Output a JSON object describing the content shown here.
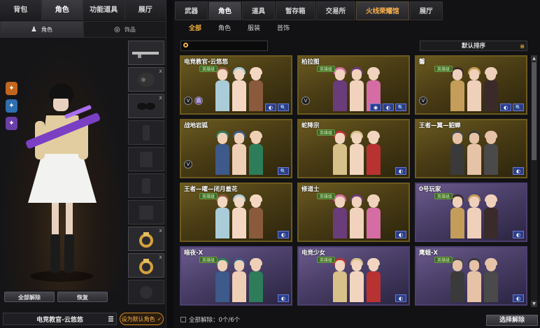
{
  "left_tabs": [
    "背包",
    "角色",
    "功能道具",
    "展厅"
  ],
  "left_active_tab": 1,
  "subtabs": [
    {
      "label": "角色"
    },
    {
      "label": "饰品"
    }
  ],
  "left_buttons": {
    "unlock_all": "全部解除",
    "restore": "恢复"
  },
  "current_character": "电竞教官-云悠悠",
  "set_default": "设为默认角色",
  "set_default_check": "✓",
  "right_tabs": [
    "武器",
    "角色",
    "道具",
    "暂存箱",
    "交易所",
    "火线荣耀馆",
    "展厅"
  ],
  "right_active_tab": 1,
  "right_highlight_tab": 5,
  "category_tabs": [
    "全部",
    "角色",
    "服装",
    "首饰"
  ],
  "category_active": 0,
  "sort_label": "默认排序",
  "cards": [
    {
      "title": "电竞教官-云悠悠",
      "tag": "英雄级",
      "badges": [
        "V",
        "盾"
      ],
      "actions": [
        "◐",
        "🔍"
      ],
      "theme": "gold"
    },
    {
      "title": "柏拉图",
      "tag": "英雄级",
      "badges": [
        "V"
      ],
      "actions": [
        "◉",
        "◐",
        "🔍"
      ],
      "theme": "gold"
    },
    {
      "title": "馨",
      "tag": "英雄级",
      "badges": [
        "V"
      ],
      "actions": [
        "◐",
        "🔍"
      ],
      "theme": "gold"
    },
    {
      "title": "战地岩狐",
      "tag": "",
      "badges": [
        "V"
      ],
      "actions": [
        "🔍"
      ],
      "theme": "gold"
    },
    {
      "title": "蛇降宗",
      "tag": "英雄级",
      "badges": [],
      "actions": [
        "◐"
      ],
      "theme": "gold"
    },
    {
      "title": "王者—翼—貂蝉",
      "tag": "",
      "badges": [],
      "actions": [
        "◐"
      ],
      "theme": "gold"
    },
    {
      "title": "王者—曜—闭月羞花",
      "tag": "英雄级",
      "badges": [],
      "actions": [
        "◐"
      ],
      "theme": "gold"
    },
    {
      "title": "修道士",
      "tag": "英雄级",
      "badges": [],
      "actions": [
        "◐"
      ],
      "theme": "gold"
    },
    {
      "title": "0号玩家",
      "tag": "英雄级",
      "badges": [],
      "actions": [
        "◐"
      ],
      "theme": "purple"
    },
    {
      "title": "暗夜-X",
      "tag": "英雄级",
      "badges": [],
      "actions": [
        "◐"
      ],
      "theme": "purple"
    },
    {
      "title": "电竞少女",
      "tag": "英雄级",
      "badges": [],
      "actions": [
        "◐"
      ],
      "theme": "purple"
    },
    {
      "title": "鹰蛾-X",
      "tag": "英雄级",
      "badges": [],
      "actions": [
        "◐"
      ],
      "theme": "purple"
    }
  ],
  "unlock_status": "全部解除：0个/6个",
  "select_unlock": "选择解除",
  "colors": {
    "accent": "#f0b23c",
    "gold_border": "#6d5a1f",
    "purple_border": "#4c3f70",
    "action_blue": "#2a3e8e"
  }
}
